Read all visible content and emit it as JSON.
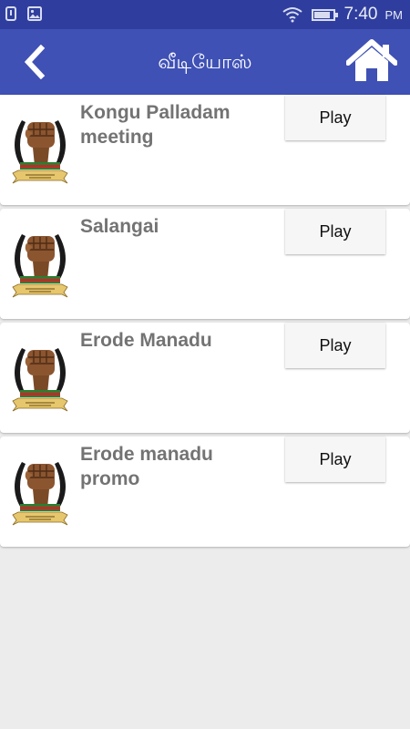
{
  "status_bar": {
    "time": "7:40",
    "ampm": "PM",
    "icons": [
      "notification-icon",
      "image-icon",
      "wifi-icon",
      "battery-icon"
    ]
  },
  "app_bar": {
    "title": "வீடியோஸ்",
    "back_icon": "chevron-left-icon",
    "home_icon": "home-icon",
    "color": "#3f51b5",
    "status_color": "#2f3e9e"
  },
  "videos": [
    {
      "title": "Kongu Palladam meeting",
      "play_label": "Play"
    },
    {
      "title": "Salangai",
      "play_label": "Play"
    },
    {
      "title": "Erode Manadu",
      "play_label": "Play"
    },
    {
      "title": "Erode manadu promo",
      "play_label": "Play"
    }
  ]
}
